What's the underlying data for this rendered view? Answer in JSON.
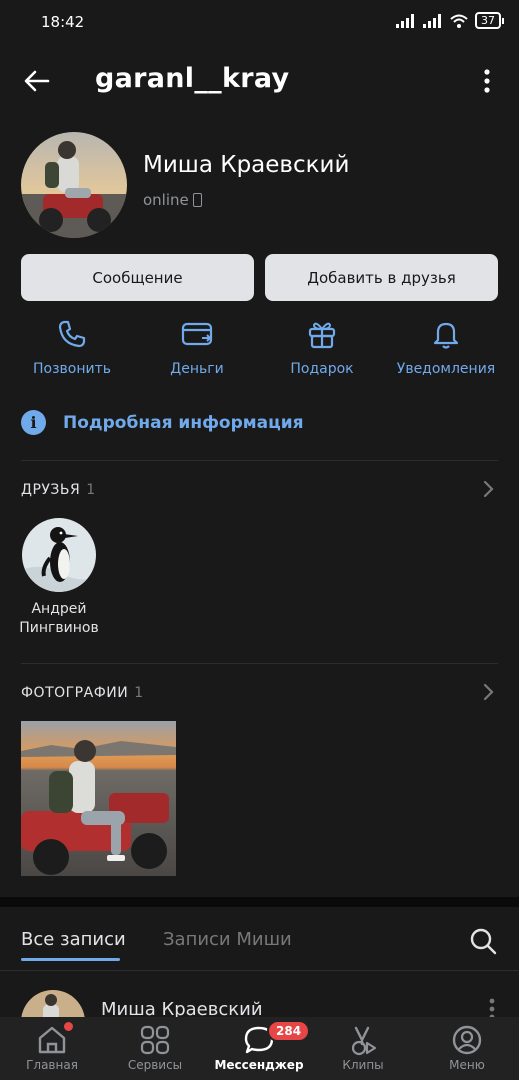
{
  "status_bar": {
    "time": "18:42",
    "battery": "37"
  },
  "header": {
    "username": "garanl__kray"
  },
  "profile": {
    "name": "Миша Краевский",
    "status": "online"
  },
  "buttons": {
    "message": "Сообщение",
    "add_friend": "Добавить в друзья"
  },
  "actions": [
    {
      "label": "Позвонить",
      "icon": "phone-icon"
    },
    {
      "label": "Деньги",
      "icon": "card-icon"
    },
    {
      "label": "Подарок",
      "icon": "gift-icon"
    },
    {
      "label": "Уведомления",
      "icon": "bell-icon"
    }
  ],
  "info_link": {
    "label": "Подробная информация"
  },
  "friends": {
    "title": "ДРУЗЬЯ",
    "count": "1",
    "items": [
      {
        "name_line1": "Андрей",
        "name_line2": "Пингвинов"
      }
    ]
  },
  "photos": {
    "title": "ФОТОГРАФИИ",
    "count": "1"
  },
  "wall": {
    "tabs": [
      {
        "label": "Все записи",
        "active": true
      },
      {
        "label": "Записи Миши",
        "active": false
      }
    ],
    "post_author": "Миша Краевский"
  },
  "nav": [
    {
      "label": "Главная",
      "icon": "home-icon"
    },
    {
      "label": "Сервисы",
      "icon": "services-icon"
    },
    {
      "label": "Мессенджер",
      "icon": "chat-icon",
      "badge": "284",
      "active": true
    },
    {
      "label": "Клипы",
      "icon": "clips-icon"
    },
    {
      "label": "Меню",
      "icon": "profile-icon"
    }
  ],
  "colors": {
    "accent": "#71aaeb",
    "background": "#191919",
    "badge": "#e64646",
    "button": "#e1e3e6"
  }
}
